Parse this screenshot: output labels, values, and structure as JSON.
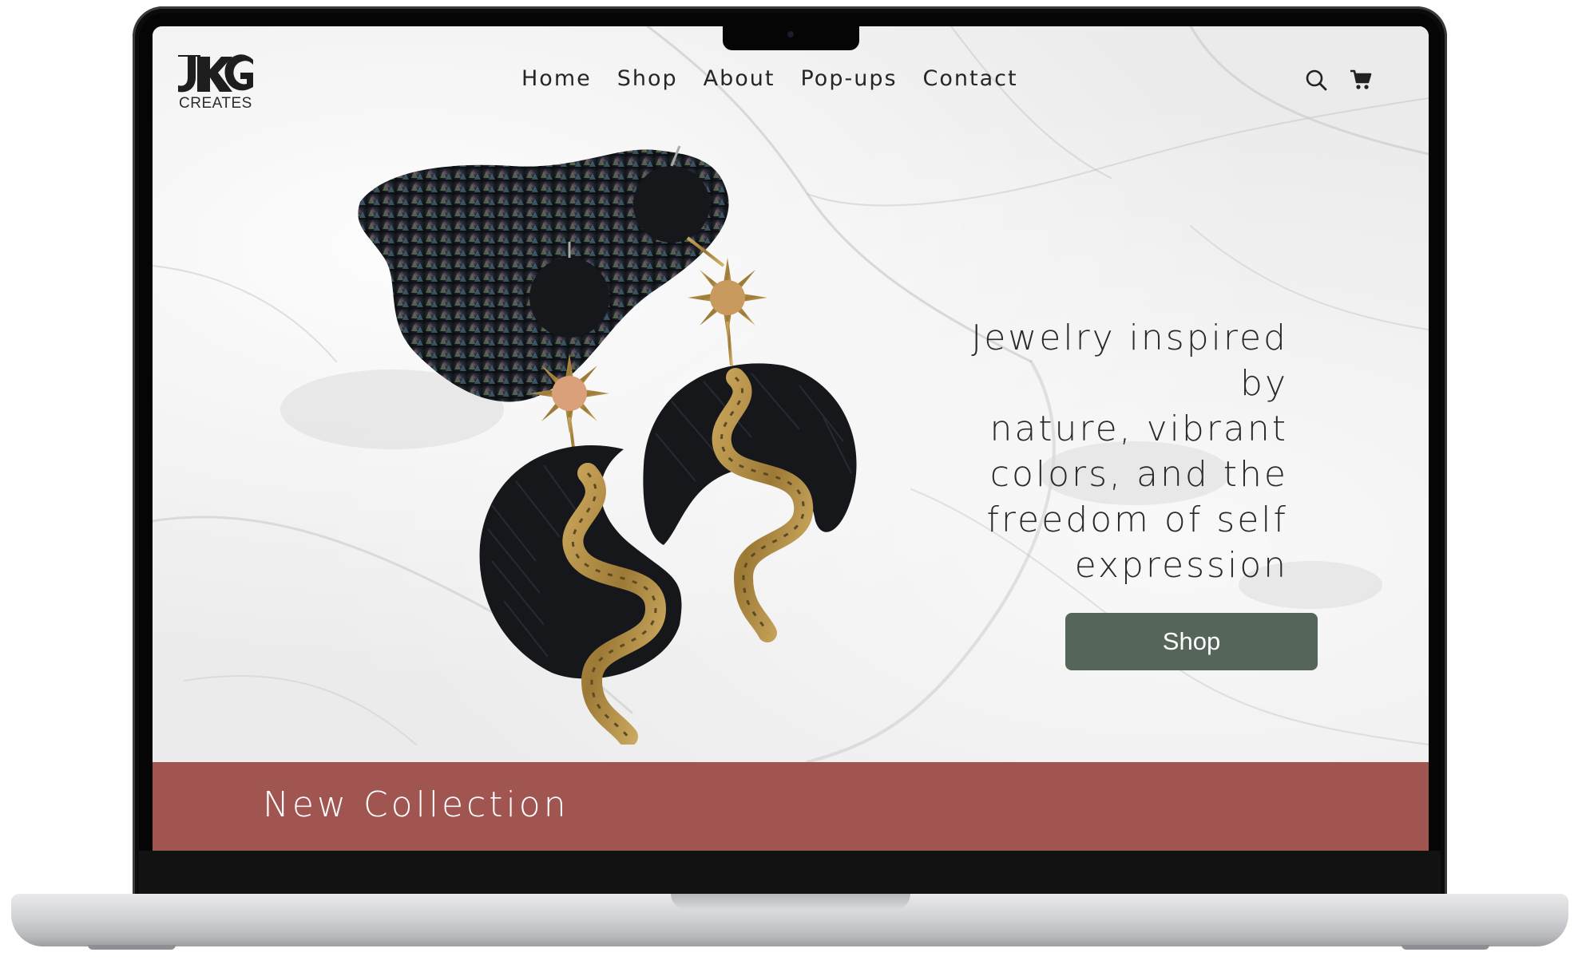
{
  "brand": {
    "logo_text": "CREATES"
  },
  "nav": {
    "items": [
      {
        "label": "Home"
      },
      {
        "label": "Shop"
      },
      {
        "label": "About"
      },
      {
        "label": "Pop-ups"
      },
      {
        "label": "Contact"
      }
    ],
    "icons": [
      "search-icon",
      "cart-icon"
    ]
  },
  "hero": {
    "tagline": "Jewelry inspired by\nnature, vibrant\ncolors, and the\nfreedom of self\nexpression",
    "cta_label": "Shop",
    "cta_color": "#55655a"
  },
  "banner": {
    "title": "New Collection",
    "color": "#a05550"
  }
}
